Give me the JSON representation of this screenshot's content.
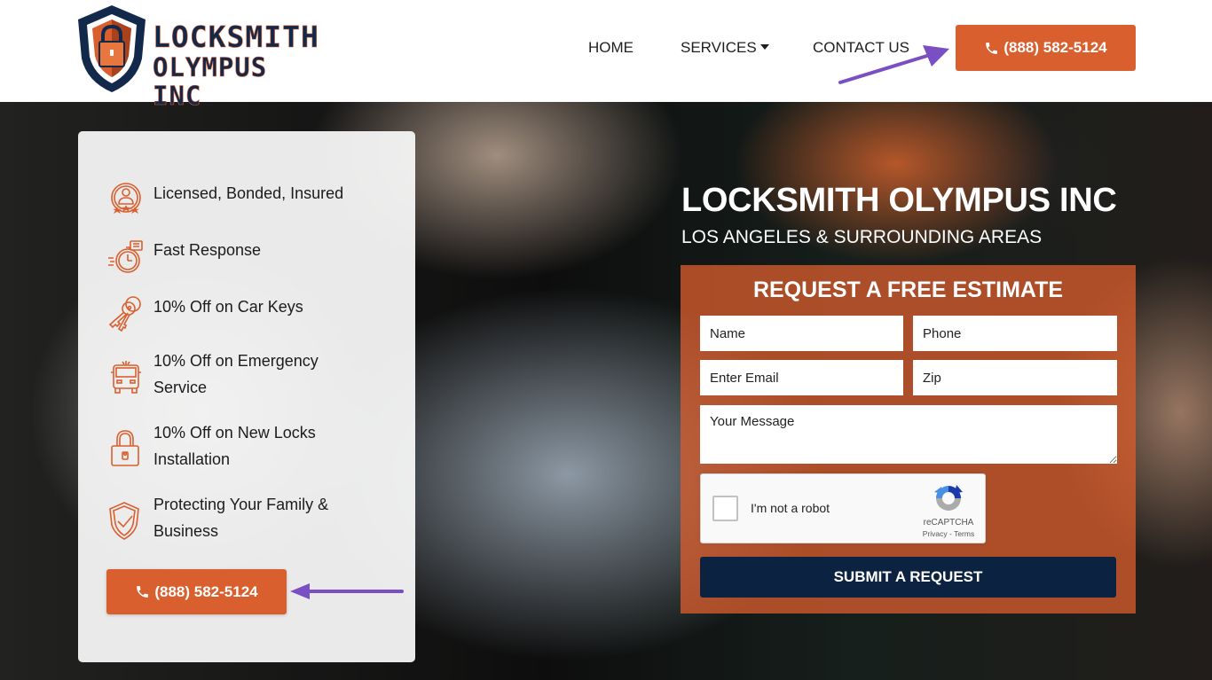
{
  "header": {
    "logo": {
      "line1": "LOCKSMITH",
      "line2": "OLYMPUS INC"
    },
    "nav": [
      {
        "label": "HOME"
      },
      {
        "label": "SERVICES",
        "has_dropdown": true
      },
      {
        "label": "CONTACT US"
      }
    ],
    "phone_button": {
      "label": "(888) 582-5124",
      "icon": "phone-icon"
    }
  },
  "features": [
    {
      "icon": "award-person-icon",
      "label": "Licensed, Bonded, Insured"
    },
    {
      "icon": "stopwatch-icon",
      "label": "Fast Response"
    },
    {
      "icon": "car-keys-icon",
      "label": "10% Off on Car Keys"
    },
    {
      "icon": "emergency-vehicle-icon",
      "label": "10% Off on Emergency Service"
    },
    {
      "icon": "padlock-icon",
      "label": "10% Off on New Locks Installation"
    },
    {
      "icon": "shield-check-icon",
      "label": "Protecting Your Family & Business"
    }
  ],
  "features_phone_button": {
    "label": "(888) 582-5124",
    "icon": "phone-icon"
  },
  "hero": {
    "title": "LOCKSMITH OLYMPUS INC",
    "subtitle": "LOS ANGELES & SURROUNDING AREAS"
  },
  "form": {
    "title": "REQUEST A FREE ESTIMATE",
    "fields": {
      "name": {
        "placeholder": "Name",
        "value": ""
      },
      "phone": {
        "placeholder": "Phone",
        "value": ""
      },
      "email": {
        "placeholder": "Enter Email",
        "value": ""
      },
      "zip": {
        "placeholder": "Zip",
        "value": ""
      },
      "message": {
        "placeholder": "Your Message",
        "value": ""
      }
    },
    "recaptcha": {
      "label": "I'm not a robot",
      "brand": "reCAPTCHA",
      "privacy": "Privacy",
      "separator": " - ",
      "terms": "Terms",
      "checked": false
    },
    "submit_label": "SUBMIT A REQUEST"
  },
  "colors": {
    "accent_orange": "#d95f2e",
    "navy": "#0b2341",
    "logo_navy": "#13294b",
    "annotation_arrow": "#7a4fc4"
  }
}
